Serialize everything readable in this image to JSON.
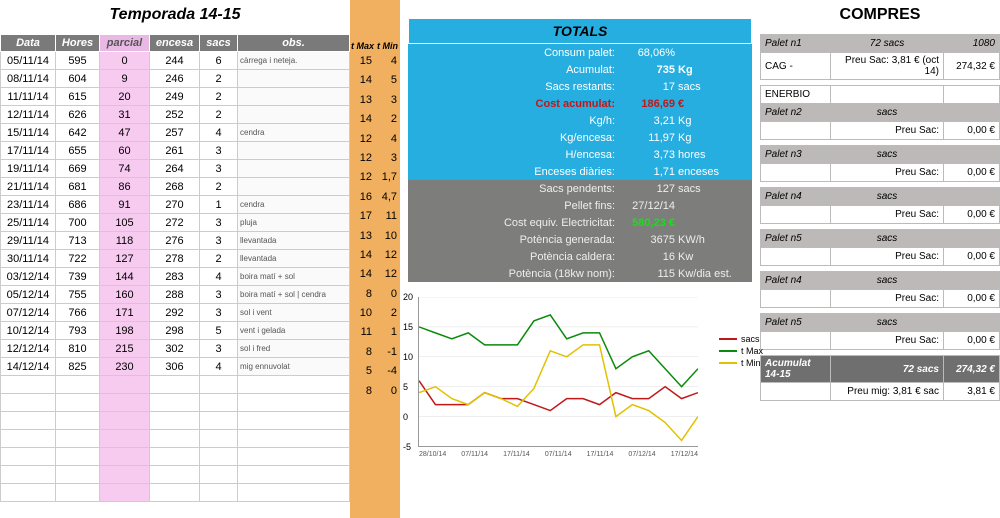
{
  "title_left": "Temporada 14-15",
  "title_right": "COMPRES",
  "headers": {
    "data": "Data",
    "hores": "Hores",
    "parcial": "parcial",
    "encesa": "encesa",
    "sacs": "sacs",
    "obs": "obs.",
    "tmax": "t Max",
    "tmin": "t Min"
  },
  "rows": [
    {
      "data": "05/11/14",
      "hores": "595",
      "parcial": "0",
      "encesa": "244",
      "sacs": "6",
      "obs": "càrrega i neteja.",
      "tmax": "15",
      "tmin": "4"
    },
    {
      "data": "08/11/14",
      "hores": "604",
      "parcial": "9",
      "encesa": "246",
      "sacs": "2",
      "obs": "",
      "tmax": "14",
      "tmin": "5"
    },
    {
      "data": "11/11/14",
      "hores": "615",
      "parcial": "20",
      "encesa": "249",
      "sacs": "2",
      "obs": "",
      "tmax": "13",
      "tmin": "3"
    },
    {
      "data": "12/11/14",
      "hores": "626",
      "parcial": "31",
      "encesa": "252",
      "sacs": "2",
      "obs": "",
      "tmax": "14",
      "tmin": "2"
    },
    {
      "data": "15/11/14",
      "hores": "642",
      "parcial": "47",
      "encesa": "257",
      "sacs": "4",
      "obs": "cendra",
      "tmax": "12",
      "tmin": "4"
    },
    {
      "data": "17/11/14",
      "hores": "655",
      "parcial": "60",
      "encesa": "261",
      "sacs": "3",
      "obs": "",
      "tmax": "12",
      "tmin": "3"
    },
    {
      "data": "19/11/14",
      "hores": "669",
      "parcial": "74",
      "encesa": "264",
      "sacs": "3",
      "obs": "",
      "tmax": "12",
      "tmin": "1,7"
    },
    {
      "data": "21/11/14",
      "hores": "681",
      "parcial": "86",
      "encesa": "268",
      "sacs": "2",
      "obs": "",
      "tmax": "16",
      "tmin": "4,7"
    },
    {
      "data": "23/11/14",
      "hores": "686",
      "parcial": "91",
      "encesa": "270",
      "sacs": "1",
      "obs": "cendra",
      "tmax": "17",
      "tmin": "11"
    },
    {
      "data": "25/11/14",
      "hores": "700",
      "parcial": "105",
      "encesa": "272",
      "sacs": "3",
      "obs": "pluja",
      "tmax": "13",
      "tmin": "10"
    },
    {
      "data": "29/11/14",
      "hores": "713",
      "parcial": "118",
      "encesa": "276",
      "sacs": "3",
      "obs": "llevantada",
      "tmax": "14",
      "tmin": "12"
    },
    {
      "data": "30/11/14",
      "hores": "722",
      "parcial": "127",
      "encesa": "278",
      "sacs": "2",
      "obs": "llevantada",
      "tmax": "14",
      "tmin": "12"
    },
    {
      "data": "03/12/14",
      "hores": "739",
      "parcial": "144",
      "encesa": "283",
      "sacs": "4",
      "obs": "boira matí + sol",
      "tmax": "8",
      "tmin": "0"
    },
    {
      "data": "05/12/14",
      "hores": "755",
      "parcial": "160",
      "encesa": "288",
      "sacs": "3",
      "obs": "boira matí + sol | cendra",
      "tmax": "10",
      "tmin": "2"
    },
    {
      "data": "07/12/14",
      "hores": "766",
      "parcial": "171",
      "encesa": "292",
      "sacs": "3",
      "obs": "sol i vent",
      "tmax": "11",
      "tmin": "1"
    },
    {
      "data": "10/12/14",
      "hores": "793",
      "parcial": "198",
      "encesa": "298",
      "sacs": "5",
      "obs": "vent i gelada",
      "tmax": "8",
      "tmin": "-1"
    },
    {
      "data": "12/12/14",
      "hores": "810",
      "parcial": "215",
      "encesa": "302",
      "sacs": "3",
      "obs": "sol i fred",
      "tmax": "5",
      "tmin": "-4"
    },
    {
      "data": "14/12/14",
      "hores": "825",
      "parcial": "230",
      "encesa": "306",
      "sacs": "4",
      "obs": "mig ennuvolat",
      "tmax": "8",
      "tmin": "0"
    }
  ],
  "empty_rows": 7,
  "totals_title": "TOTALS",
  "totals_blue": [
    {
      "lbl": "Consum palet:",
      "val": "68,06%",
      "unit": "",
      "bold": false
    },
    {
      "lbl": "Acumulat:",
      "val": "735",
      "unit": "Kg",
      "bold": true
    },
    {
      "lbl": "Sacs restants:",
      "val": "17",
      "unit": "sacs",
      "bold": false
    },
    {
      "lbl": "Cost acumulat:",
      "val": "186,69",
      "unit": "€",
      "cost": true
    },
    {
      "lbl": "Kg/h:",
      "val": "3,21",
      "unit": "Kg",
      "bold": false
    },
    {
      "lbl": "Kg/encesa:",
      "val": "11,97",
      "unit": "Kg",
      "bold": false
    },
    {
      "lbl": "H/encesa:",
      "val": "3,73",
      "unit": "hores",
      "bold": false
    },
    {
      "lbl": "Enceses diàries:",
      "val": "1,71",
      "unit": "enceses",
      "bold": false
    }
  ],
  "totals_grey": [
    {
      "lbl": "Sacs pendents:",
      "val": "127",
      "unit": "sacs"
    },
    {
      "lbl": "Pellet fins:",
      "val": "27/12/14",
      "unit": ""
    },
    {
      "lbl": "Cost equiv. Electricitat:",
      "val": "580,23 €",
      "unit": "",
      "green": true
    },
    {
      "lbl": "Potència generada:",
      "val": "3675",
      "unit": "KW/h"
    },
    {
      "lbl": "Potència caldera:",
      "val": "16",
      "unit": "Kw"
    },
    {
      "lbl": "Potència (18kw nom):",
      "val": "115",
      "unit": "Kw/dia est."
    }
  ],
  "compres": [
    {
      "type": "grey",
      "c1": "Palet n1",
      "c2": "72 sacs",
      "c3": "1080"
    },
    {
      "type": "plain",
      "c1": "CAG -",
      "c2": "Preu Sac: 3,81 € (oct 14)",
      "c3": "274,32 €"
    },
    {
      "type": "plain",
      "c1": "ENERBIO",
      "c2": "",
      "c3": ""
    },
    {
      "type": "grey",
      "c1": "Palet n2",
      "c2": "sacs",
      "c3": ""
    },
    {
      "type": "plain",
      "c1": "",
      "c2": "Preu Sac:",
      "c3": "0,00 €"
    },
    {
      "type": "grey",
      "c1": "Palet n3",
      "c2": "sacs",
      "c3": ""
    },
    {
      "type": "plain",
      "c1": "",
      "c2": "Preu Sac:",
      "c3": "0,00 €"
    },
    {
      "type": "grey",
      "c1": "Palet n4",
      "c2": "sacs",
      "c3": ""
    },
    {
      "type": "plain",
      "c1": "",
      "c2": "Preu Sac:",
      "c3": "0,00 €"
    },
    {
      "type": "grey",
      "c1": "Palet n5",
      "c2": "sacs",
      "c3": ""
    },
    {
      "type": "plain",
      "c1": "",
      "c2": "Preu Sac:",
      "c3": "0,00 €"
    },
    {
      "type": "grey",
      "c1": "Palet n4",
      "c2": "sacs",
      "c3": ""
    },
    {
      "type": "plain",
      "c1": "",
      "c2": "Preu Sac:",
      "c3": "0,00 €"
    },
    {
      "type": "grey",
      "c1": "Palet n5",
      "c2": "sacs",
      "c3": ""
    },
    {
      "type": "plain",
      "c1": "",
      "c2": "Preu Sac:",
      "c3": "0,00 €"
    },
    {
      "type": "dark",
      "c1": "Acumulat 14-15",
      "c2": "72 sacs",
      "c3": "274,32 €"
    },
    {
      "type": "plain",
      "c1": "",
      "c2": "Preu mig: 3,81 € sac",
      "c3": "3,81 €"
    }
  ],
  "chart_data": {
    "type": "line",
    "x": [
      "28/10/14",
      "07/11/14",
      "17/11/14",
      "07/11/14",
      "17/11/14",
      "07/12/14",
      "17/12/14"
    ],
    "ylim": [
      -5,
      20
    ],
    "yticks": [
      -5,
      0,
      5,
      10,
      15,
      20
    ],
    "series": [
      {
        "name": "sacs",
        "color": "#c01818",
        "values": [
          6,
          2,
          2,
          2,
          4,
          3,
          3,
          2,
          1,
          3,
          3,
          2,
          4,
          3,
          3,
          5,
          3,
          4
        ]
      },
      {
        "name": "t Max",
        "color": "#0b8a0b",
        "values": [
          15,
          14,
          13,
          14,
          12,
          12,
          12,
          16,
          17,
          13,
          14,
          14,
          8,
          10,
          11,
          8,
          5,
          8
        ]
      },
      {
        "name": "t Min",
        "color": "#e0c200",
        "values": [
          4,
          5,
          3,
          2,
          4,
          3,
          1.7,
          4.7,
          11,
          10,
          12,
          12,
          0,
          2,
          1,
          -1,
          -4,
          0
        ]
      }
    ]
  },
  "legend_labels": {
    "sacs": "sacs",
    "tmax": "t Max",
    "tmin": "t Min"
  }
}
